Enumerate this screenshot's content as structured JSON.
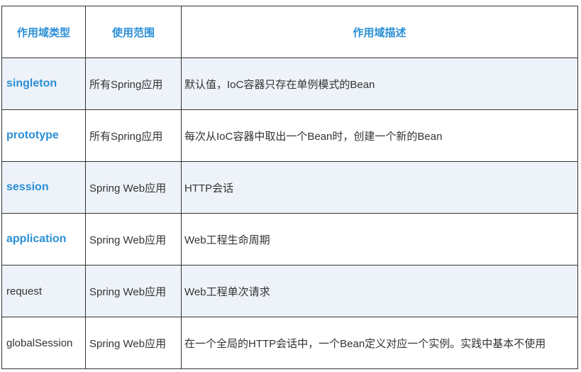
{
  "headers": [
    "作用域类型",
    "使用范围",
    "作用域描述"
  ],
  "rows": [
    {
      "scope": "singleton",
      "range": "所有Spring应用",
      "desc": "默认值，IoC容器只存在单例模式的Bean",
      "highlight": true
    },
    {
      "scope": "prototype",
      "range": "所有Spring应用",
      "desc": "每次从IoC容器中取出一个Bean时，创建一个新的Bean",
      "highlight": true
    },
    {
      "scope": "session",
      "range": "Spring Web应用",
      "desc": "HTTP会话",
      "highlight": true
    },
    {
      "scope": "application",
      "range": "Spring Web应用",
      "desc": "Web工程生命周期",
      "highlight": true
    },
    {
      "scope": "request",
      "range": "Spring Web应用",
      "desc": "Web工程单次请求",
      "highlight": false
    },
    {
      "scope": "globalSession",
      "range": "Spring Web应用",
      "desc": "在一个全局的HTTP会话中，一个Bean定义对应一个实例。实践中基本不使用",
      "highlight": false
    }
  ],
  "colors": {
    "accent": "#2a8fd6",
    "shade": "#eef3fa",
    "border": "#333333"
  }
}
